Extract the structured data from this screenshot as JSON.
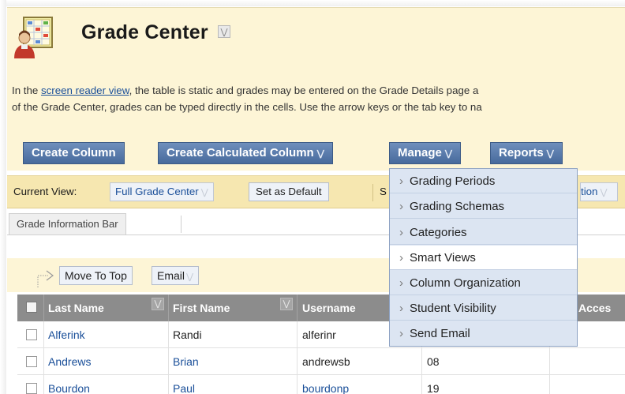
{
  "page": {
    "title": "Grade Center",
    "title_menu_icon": "chevron-down-icon"
  },
  "info": {
    "line1_prefix": "In the ",
    "line1_link": "screen reader view",
    "line1_suffix": ", the table is static and grades may be entered on the Grade Details page a",
    "line2": "of the Grade Center, grades can be typed directly in the cells. Use the arrow keys or the tab key to na"
  },
  "toolbar": {
    "create_column": "Create Column",
    "create_calculated_column": "Create Calculated Column",
    "manage": "Manage",
    "reports": "Reports"
  },
  "viewbar": {
    "current_view_label": "Current View:",
    "current_view_value": "Full Grade Center",
    "set_default": "Set as Default",
    "second_label": "S",
    "second_select": "tion"
  },
  "info_bar": {
    "tab_label": "Grade Information Bar"
  },
  "actions": {
    "move_to_top": "Move To Top",
    "email": "Email"
  },
  "table": {
    "columns": [
      "Last Name",
      "First Name",
      "Username",
      "",
      "t Acces"
    ],
    "rows": [
      {
        "last": "Alferink",
        "first": "Randi",
        "username": "alferinr",
        "col4": ""
      },
      {
        "last": "Andrews",
        "first": "Brian",
        "username": "andrewsb",
        "col4": "08"
      },
      {
        "last": "Bourdon",
        "first": "Paul",
        "username": "bourdonp",
        "col4": "19"
      }
    ]
  },
  "manage_menu": {
    "items": [
      {
        "label": "Grading Periods"
      },
      {
        "label": "Grading Schemas"
      },
      {
        "label": "Categories"
      },
      {
        "label": "Smart Views",
        "highlighted": true
      },
      {
        "label": "Column Organization"
      },
      {
        "label": "Student Visibility"
      },
      {
        "label": "Send Email"
      }
    ]
  },
  "colors": {
    "button_blue": "#476a9c",
    "header_bg": "#fdf5d6",
    "viewbar_bg": "#f6e7b0",
    "table_header": "#8c8c8c",
    "link": "#1a4f99",
    "dropdown_bg": "#dce5f2"
  }
}
